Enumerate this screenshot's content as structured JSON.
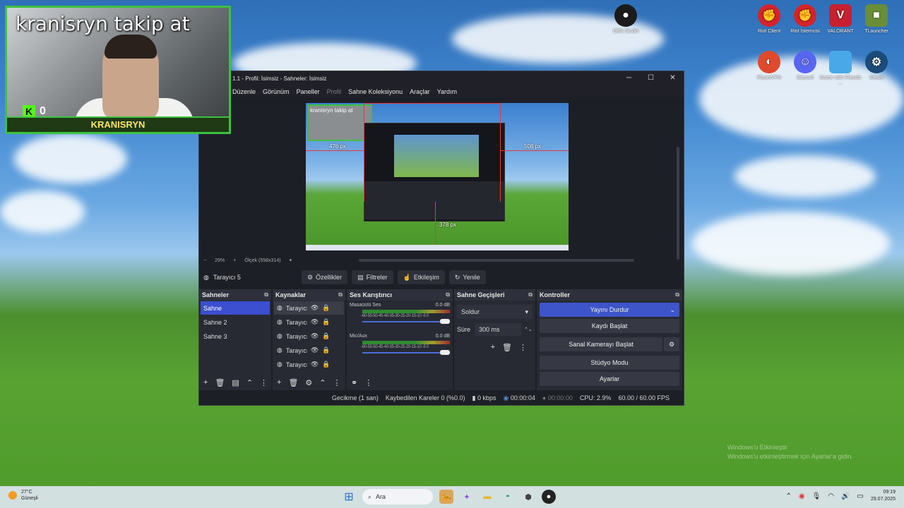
{
  "webcam": {
    "overlay_text": "kranisryn takip at",
    "name_label": "KRANISRYN",
    "follower_count": "0"
  },
  "desktop_icons": [
    {
      "label": "OBS Studio",
      "icon": "obs-icon",
      "color": "#1b1b1b"
    },
    {
      "label": "Riot Client",
      "icon": "riot-client-icon",
      "color": "#d6232a"
    },
    {
      "label": "Riot İstemcisi",
      "icon": "riot-icon",
      "color": "#d6232a"
    },
    {
      "label": "VALORANT",
      "icon": "valorant-icon",
      "color": "#c7202f"
    },
    {
      "label": "TLauncher",
      "icon": "tlauncher-icon",
      "color": "#6a8d3a"
    },
    {
      "label": "PlanetVPN",
      "icon": "planetvpn-icon",
      "color": "#e04a2c"
    },
    {
      "label": "Discord",
      "icon": "discord-icon",
      "color": "#5865f2"
    },
    {
      "label": "Game with Friends ...",
      "icon": "game-icon",
      "color": "#49a9e8"
    },
    {
      "label": "Steam",
      "icon": "steam-icon",
      "color": "#1b4b78"
    }
  ],
  "obs": {
    "title": "1.1 - Profil: İsimsiz - Sahneler: İsimsiz",
    "window_buttons": {
      "minimize": "─",
      "maximize": "☐",
      "close": "✕"
    },
    "menu": [
      "Düzenle",
      "Görünüm",
      "Paneller",
      "Profil",
      "Sahne Koleksiyonu",
      "Araçlar",
      "Yardım"
    ],
    "preview": {
      "overlay_text": "kranisryn takip at",
      "label_left": "476 px",
      "label_right": "508 px",
      "label_bottom": "378 px"
    },
    "zoom": {
      "minus": "−",
      "value": "29%",
      "plus": "+",
      "scale": "Ölçek (558x314)"
    },
    "context": {
      "source": "Tarayıcı 5",
      "buttons": [
        "Özellikler",
        "Filtreler",
        "Etkileşim",
        "Yenile"
      ]
    },
    "scenes": {
      "title": "Sahneler",
      "items": [
        "Sahne",
        "Sahne 2",
        "Sahne 3"
      ],
      "selected": 0
    },
    "sources": {
      "title": "Kaynaklar",
      "items": [
        "Tarayıcı 5",
        "Tarayıcı 4",
        "Tarayıcı 3",
        "Tarayıcı 2",
        "Tarayıcı 1"
      ]
    },
    "mixer": {
      "title": "Ses Karıştırıcı",
      "scale": "-60-55-50-45-40-35-30-25-20-15-10 -5 0",
      "channels": [
        {
          "name": "Masaüstü Ses",
          "level": "0.0 dB"
        },
        {
          "name": "Mic/Aux",
          "level": "0.0 dB"
        }
      ]
    },
    "transitions": {
      "title": "Sahne Geçişleri",
      "selected": "Soldur",
      "duration_label": "Süre",
      "duration": "300 ms"
    },
    "controls": {
      "title": "Kontroller",
      "buttons": [
        "Yayını Durdur",
        "Kaydı Başlat",
        "Sanal Kamerayı Başlat",
        "Stüdyo Modu",
        "Ayarlar"
      ]
    },
    "status": {
      "delay": "Gecikme (1 san)",
      "dropped": "Kaybedilen Kareler 0 (%0.0)",
      "bitrate": "0 kbps",
      "stream_time": "00:00:04",
      "rec_time": "00:00:00",
      "cpu": "CPU: 2.9%",
      "fps": "60.00 / 60.00 FPS"
    }
  },
  "watermark": {
    "line1": "Windows'u Etkinleştir",
    "line2": "Windows'u etkinleştirmek için Ayarlar'a gidin."
  },
  "taskbar": {
    "weather_temp": "27°C",
    "weather_desc": "Güneşli",
    "search_placeholder": "Ara",
    "time": "09:19",
    "date": "29.07.2025"
  }
}
